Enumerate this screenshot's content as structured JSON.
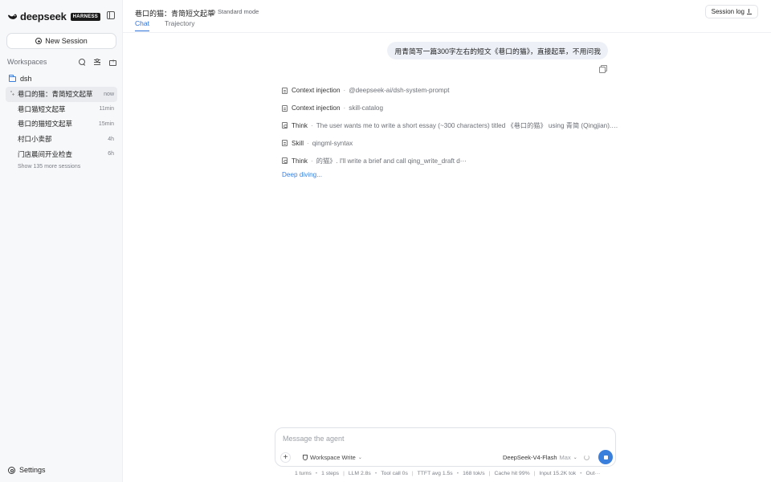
{
  "sidebar": {
    "brand": "deepseek",
    "badge": "HARNESS",
    "new_session": "New Session",
    "workspaces_title": "Workspaces",
    "workspace": "dsh",
    "sessions": [
      {
        "title": "巷口的猫：青简短文起草",
        "time": "now"
      },
      {
        "title": "巷口猫短文起草",
        "time": "11min"
      },
      {
        "title": "巷口的猫短文起草",
        "time": "15min"
      },
      {
        "title": "村口小卖部",
        "time": "4h"
      },
      {
        "title": "门店晨间开业检查",
        "time": "6h"
      }
    ],
    "show_more": "Show 135 more sessions",
    "settings": "Settings"
  },
  "header": {
    "title": "巷口的猫：青简短文起草",
    "mode": "Standard mode",
    "tabs": [
      "Chat",
      "Trajectory"
    ],
    "session_log": "Session log"
  },
  "chat": {
    "user_message": "用青简写一篇300字左右的短文《巷口的猫》，直接起草，不用问我",
    "steps": [
      {
        "icon": "doc",
        "label": "Context injection",
        "detail": "@deepseek-ai/dsh-system-prompt"
      },
      {
        "icon": "doc",
        "label": "Context injection",
        "detail": "skill-catalog"
      },
      {
        "icon": "think",
        "label": "Think",
        "detail": "The user wants me to write a short essay (~300 characters) titled 《巷口的猫》 using 青简 (Qingjian). T···"
      },
      {
        "icon": "doc",
        "label": "Skill",
        "detail": "qingml-syntax"
      },
      {
        "icon": "think",
        "label": "Think",
        "detail": "的猫》. I'll write a brief and call qing_write_draft d···"
      }
    ],
    "status": "Deep diving..."
  },
  "composer": {
    "placeholder": "Message the agent",
    "permission": "Workspace Write",
    "model": "DeepSeek-V4-Flash",
    "effort": "Max"
  },
  "stats": {
    "turns": "1 turns",
    "steps": "1 steps",
    "llm": "LLM 2.8s",
    "tool": "Tool call 0s",
    "ttft": "TTFT avg 1.5s",
    "speed": "168 tok/s",
    "cache": "Cache hit 99%",
    "input": "Input 15.2K tok",
    "output": "Out···"
  },
  "colors": {
    "accent": "#3b7fdc",
    "sidebar_bg": "#f7f8fa",
    "bubble_bg": "#edf1f7"
  }
}
